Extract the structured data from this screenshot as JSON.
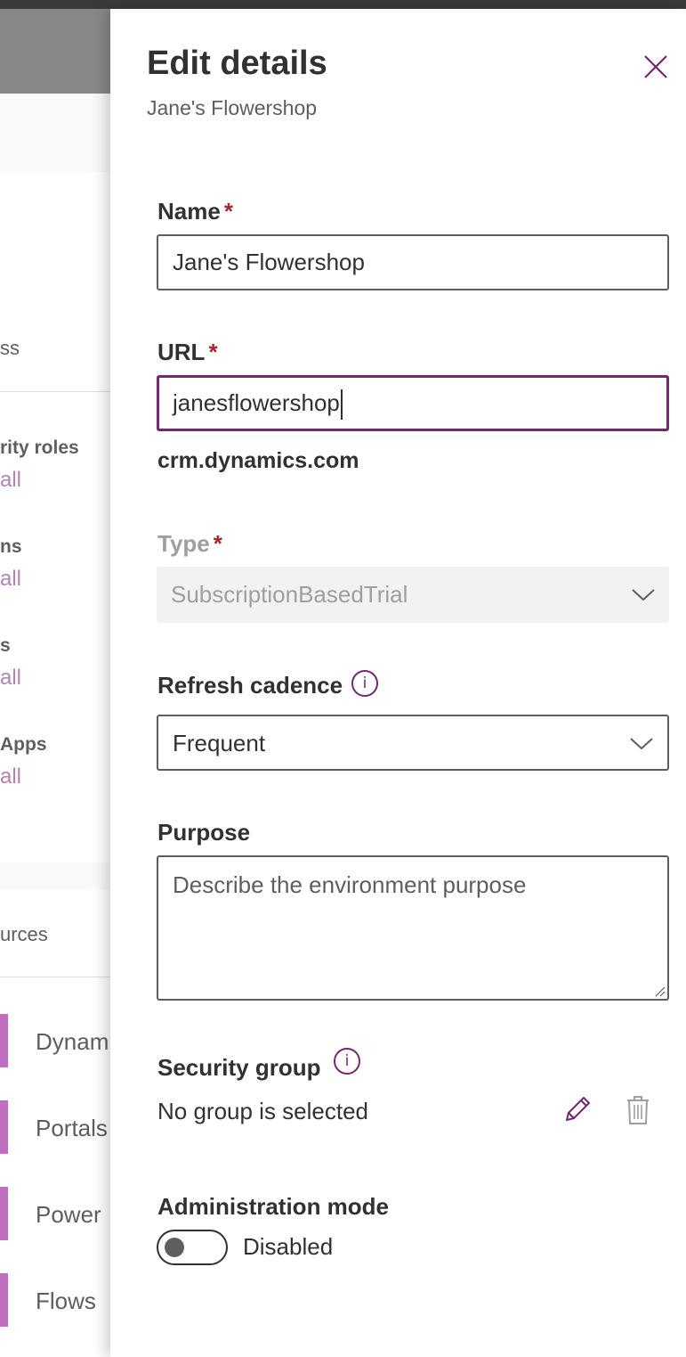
{
  "background": {
    "card2_heading": "ss",
    "settings": [
      {
        "title": "rity roles",
        "link": "all"
      },
      {
        "title": "ns",
        "link": "all"
      },
      {
        "title": "s",
        "link": "all"
      },
      {
        "title": "Apps",
        "link": "all"
      }
    ],
    "resources_heading": "urces",
    "resources": [
      "Dynam",
      "Portals",
      "Power ",
      "Flows"
    ]
  },
  "panel": {
    "title": "Edit details",
    "subtitle": "Jane's Flowershop",
    "close_icon": "close-icon"
  },
  "form": {
    "name": {
      "label": "Name",
      "required_mark": "*",
      "value": "Jane's Flowershop"
    },
    "url": {
      "label": "URL",
      "required_mark": "*",
      "value": "janesflowershop",
      "suffix": "crm.dynamics.com"
    },
    "type": {
      "label": "Type",
      "required_mark": "*",
      "value": "SubscriptionBasedTrial",
      "disabled": true
    },
    "refresh_cadence": {
      "label": "Refresh cadence",
      "info_glyph": "i",
      "value": "Frequent"
    },
    "purpose": {
      "label": "Purpose",
      "placeholder": "Describe the environment purpose"
    },
    "security_group": {
      "label": "Security group",
      "info_glyph": "i",
      "value": "No group is selected",
      "edit_icon": "pencil-icon",
      "delete_icon": "trash-icon"
    },
    "admin_mode": {
      "label": "Administration mode",
      "state": "Disabled",
      "on": false
    }
  },
  "colors": {
    "accent": "#742774",
    "required": "#a4262c",
    "link": "#b381b6",
    "resource_bar": "#c06ec0"
  }
}
